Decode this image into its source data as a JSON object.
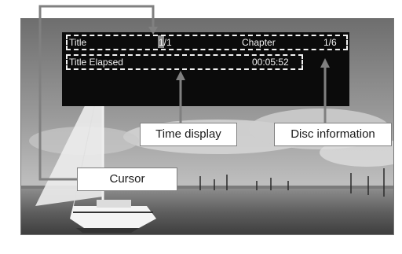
{
  "osd": {
    "title_label": "Title",
    "title_value": "1/1",
    "chapter_label": "Chapter",
    "chapter_value": "1/6",
    "elapsed_label": "Title Elapsed",
    "elapsed_value": "00:05:52"
  },
  "callouts": {
    "time_display": "Time display",
    "disc_information": "Disc information",
    "cursor": "Cursor"
  },
  "colors": {
    "osd_background": "#0b0b0b",
    "osd_text": "#f2f2f2",
    "cursor_highlight": "#8a8a8a",
    "leader_lines": "#808080"
  }
}
